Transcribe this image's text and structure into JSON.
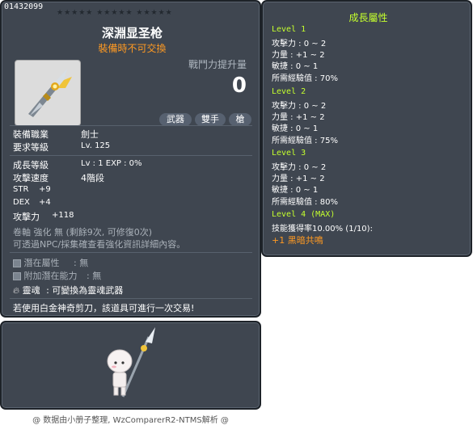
{
  "item": {
    "id": "01432099",
    "stars": "★★★★★  ★★★★★  ★★★★★",
    "name": "深淵显圣枪",
    "trade_note": "裝備時不可交換",
    "power_label": "戰鬥力提升量",
    "power_value": "0",
    "tags": [
      "武器",
      "雙手",
      "槍"
    ],
    "requirements": [
      {
        "label": "裝備職業",
        "value": "劍士"
      },
      {
        "label": "要求等級",
        "value": "Lv. 125"
      }
    ],
    "growth_level": {
      "label": "成長等級",
      "value": "Lv : 1   EXP : 0%"
    },
    "attack_speed": {
      "label": "攻擊速度",
      "value": "4階段"
    },
    "stats": [
      {
        "label": "STR",
        "value": "+9"
      },
      {
        "label": "DEX",
        "value": "+4"
      },
      {
        "label": "攻擊力",
        "value": "+118"
      }
    ],
    "upgrade_line": "卷軸 強化 無 (剩餘9次, 可修復0次)",
    "npc_line": "可透過NPC/採集確查看強化資訊詳細內容。",
    "potential": {
      "label": "潛在屬性",
      "value": ": 無"
    },
    "additional_potential": {
      "label": "附加潛在能力",
      "value": ": 無"
    },
    "soul": {
      "label": "靈魂",
      "value": ": 可變換為靈魂武器"
    },
    "scissors_note": "若使用白金神奇剪刀，該道具可進行一次交易!"
  },
  "growth": {
    "title": "成長屬性",
    "levels": [
      {
        "head": "Level 1",
        "lines": [
          "攻擊力 : 0 ~ 2",
          "力量 : +1 ~ 2",
          "敏捷 : 0 ~ 1",
          "所需經驗值 : 70%"
        ]
      },
      {
        "head": "Level 2",
        "lines": [
          "攻擊力 : 0 ~ 2",
          "力量 : +1 ~ 2",
          "敏捷 : 0 ~ 1",
          "所需經驗值 : 75%"
        ]
      },
      {
        "head": "Level 3",
        "lines": [
          "攻擊力 : 0 ~ 2",
          "力量 : +1 ~ 2",
          "敏捷 : 0 ~ 1",
          "所需經驗值 : 80%"
        ]
      },
      {
        "head": "Level 4 (MAX)",
        "lines": [
          "技能獲得率10.00% (1/10):"
        ]
      }
    ],
    "skill": "+1 黑暗共鳴"
  },
  "footer": "@ 数据由小册子整理, WzComparerR2-NTMS解析 @",
  "colors": {
    "panel": "#3f4650",
    "growth_text": "#c4ff2e",
    "orange": "#ff9a22"
  }
}
